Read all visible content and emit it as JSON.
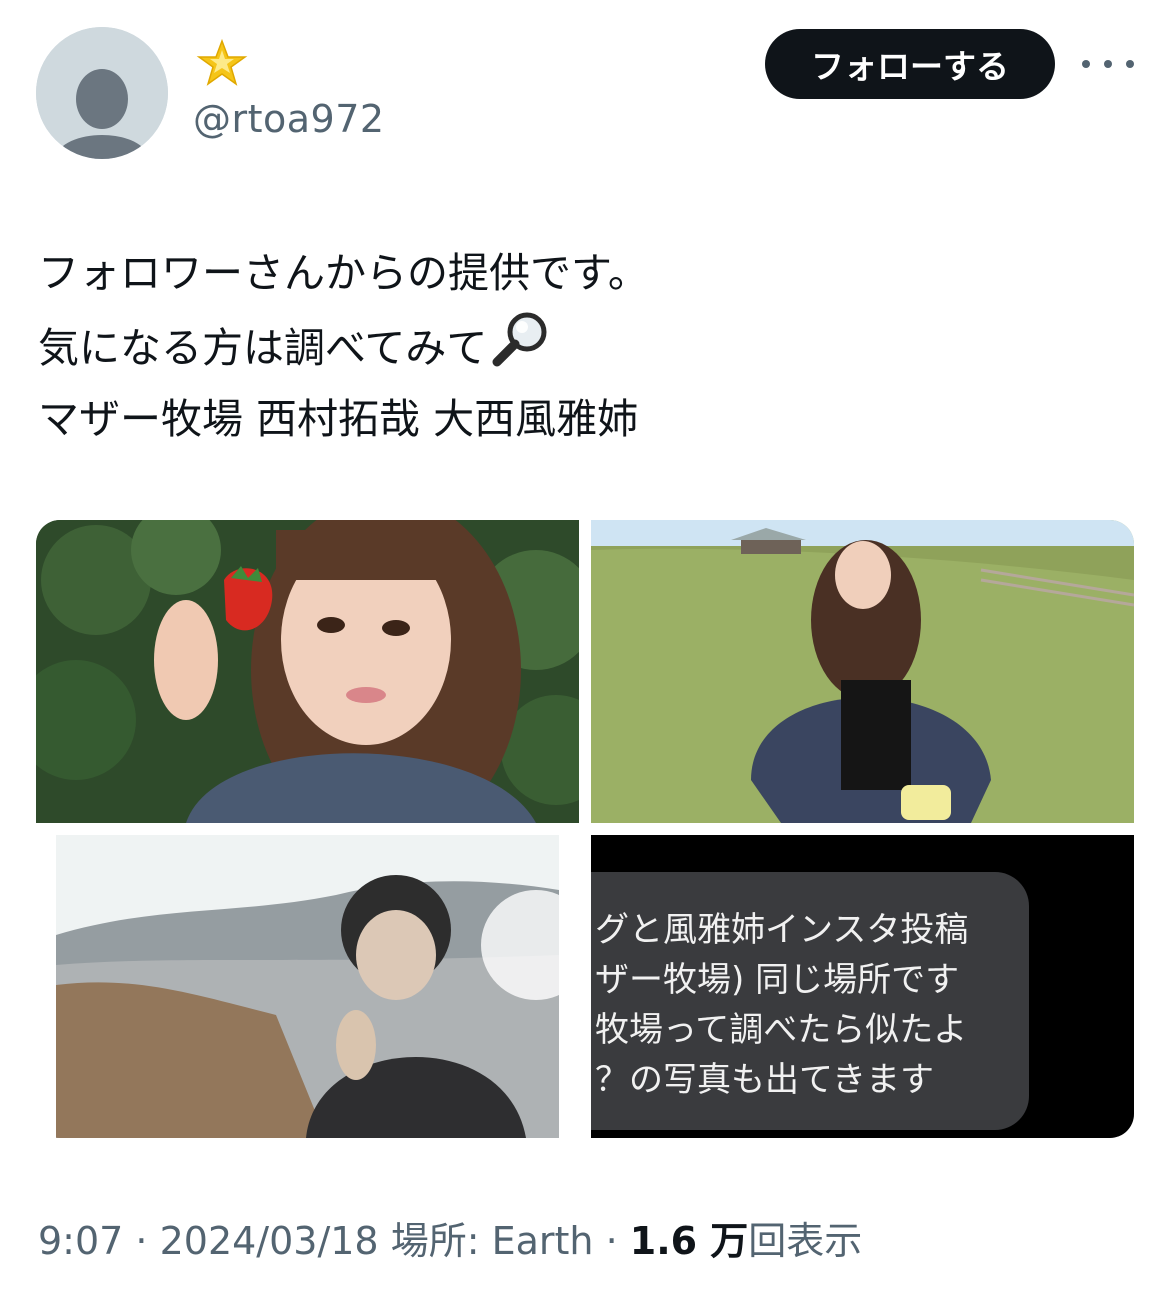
{
  "author": {
    "display_name_emoji": "star-emoji",
    "handle": "@rtoa972"
  },
  "actions": {
    "follow_label": "フォローする",
    "more_icon": "ellipsis-icon"
  },
  "tweet": {
    "lines": [
      "フォロワーさんからの提供です。",
      "気になる方は調べてみて",
      "マザー牧場 西村拓哉 大西風雅姉"
    ],
    "line2_emoji": "magnifier-emoji"
  },
  "media": [
    {
      "description_icon": "photo"
    },
    {
      "description_icon": "photo"
    },
    {
      "description_icon": "photo"
    },
    {
      "screenshot_lines": [
        "グと風雅姉インスタ投稿",
        "ザー牧場) 同じ場所です",
        "牧場って調べたら似たよ",
        "？の写真も出てきます"
      ]
    }
  ],
  "meta": {
    "time": "9:07",
    "sep1": " · ",
    "date": "2024/03/18",
    "location": " 場所: Earth",
    "sep2": " · ",
    "views_count": "1.6 万",
    "views_label": "回表示"
  },
  "colors": {
    "text_primary": "#0f1419",
    "text_secondary": "#536471",
    "button_bg": "#0f1419"
  }
}
